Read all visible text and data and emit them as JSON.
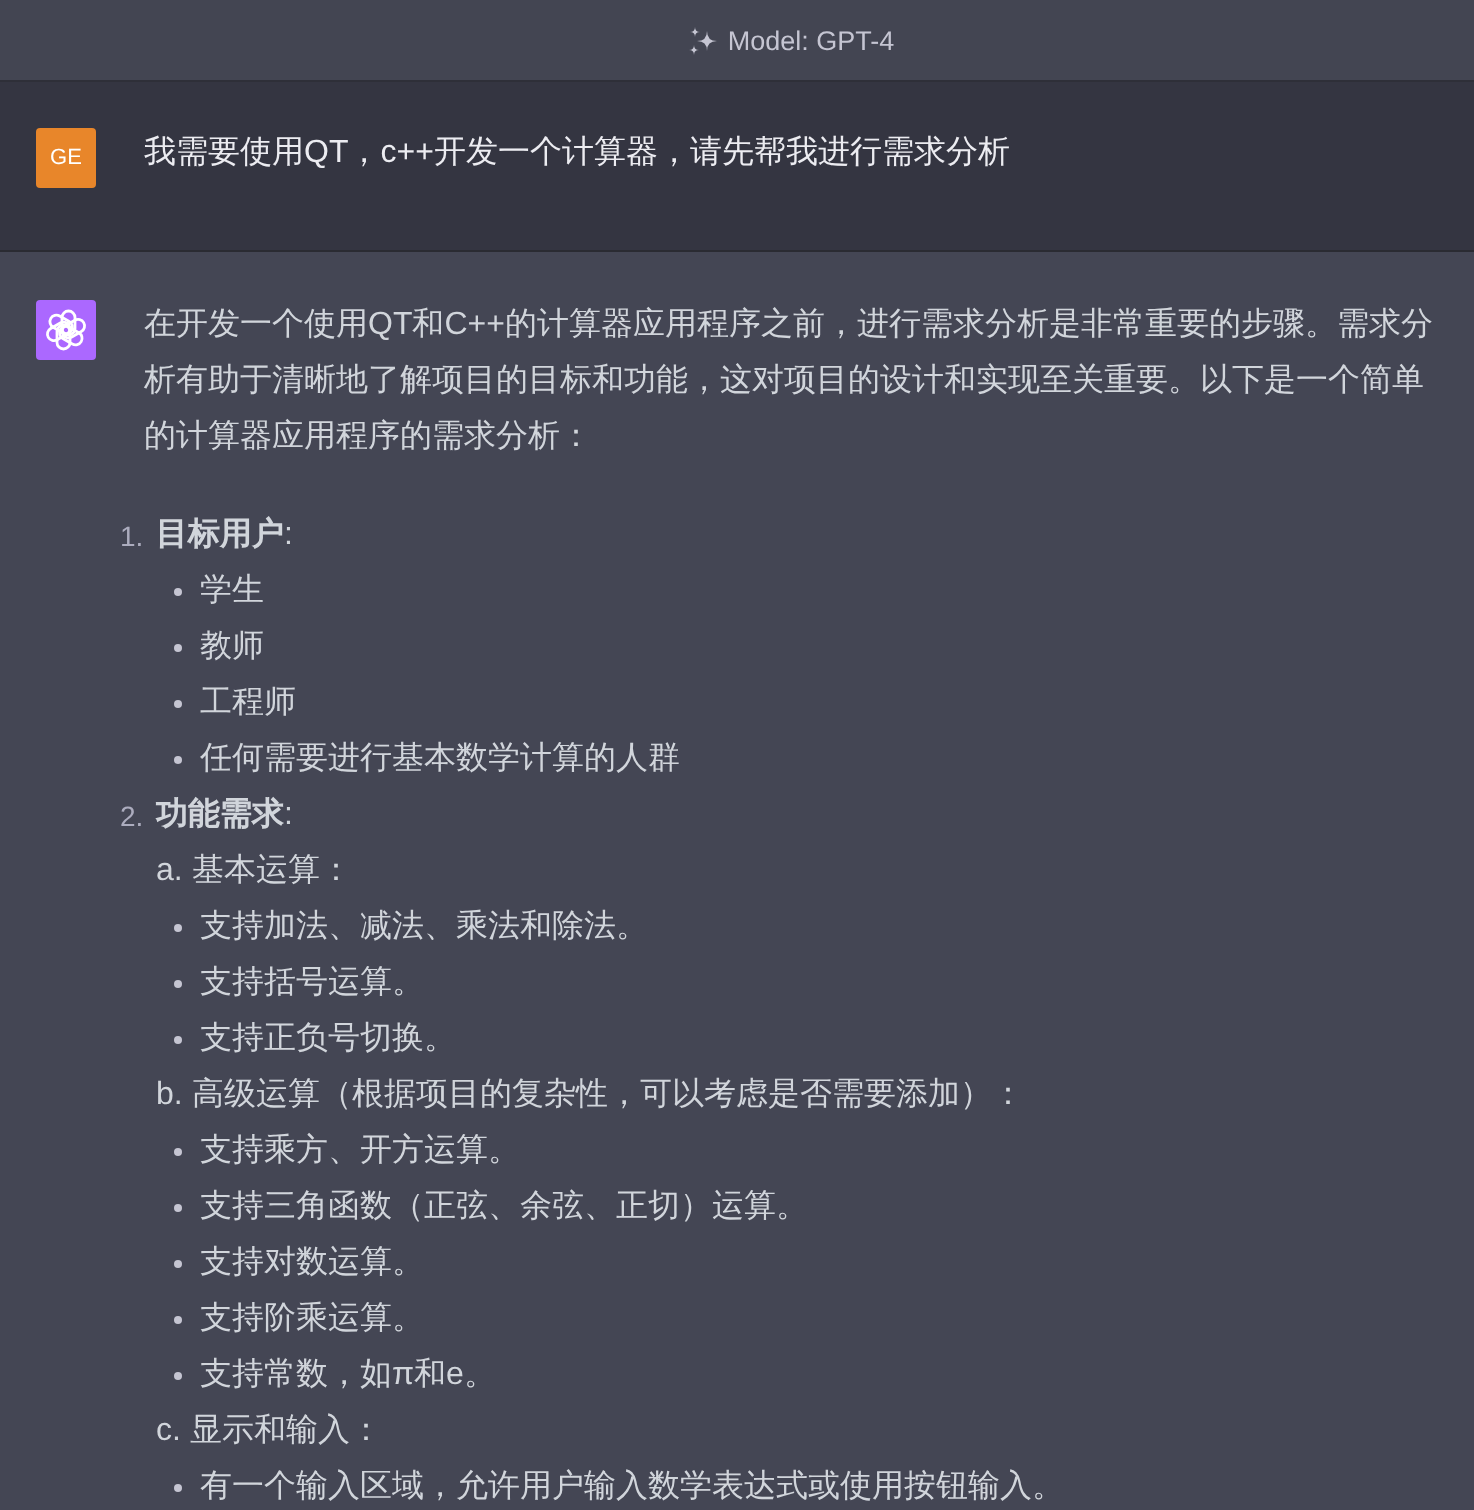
{
  "header": {
    "model_label": "Model: GPT-4"
  },
  "messages": [
    {
      "kind": "user",
      "avatar": "GE",
      "text": "我需要使用QT，c++开发一个计算器，请先帮我进行需求分析"
    },
    {
      "kind": "assistant",
      "paragraph": "在开发一个使用QT和C++的计算器应用程序之前，进行需求分析是非常重要的步骤。需求分析有助于清晰地了解项目的目标和功能，这对项目的设计和实现至关重要。以下是一个简单的计算器应用程序的需求分析：",
      "list": [
        {
          "number": "1.",
          "title": "**目标用户**:",
          "bullets": [
            "学生",
            "教师",
            "工程师",
            "任何需要进行基本数学计算的人群"
          ]
        },
        {
          "number": "2.",
          "title": "**功能需求**:",
          "sections": [
            {
              "title": "a. 基本运算：",
              "bullets": [
                "支持加法、减法、乘法和除法。",
                "支持括号运算。",
                "支持正负号切换。"
              ]
            },
            {
              "title": "b. 高级运算（根据项目的复杂性，可以考虑是否需要添加）：",
              "bullets": [
                "支持乘方、开方运算。",
                "支持三角函数（正弦、余弦、正切）运算。",
                "支持对数运算。",
                "支持阶乘运算。",
                "支持常数，如π和e。"
              ]
            },
            {
              "title": "c. 显示和输入：",
              "bullets": [
                "有一个输入区域，允许用户输入数学表达式或使用按钮输入。"
              ]
            }
          ]
        }
      ]
    }
  ]
}
